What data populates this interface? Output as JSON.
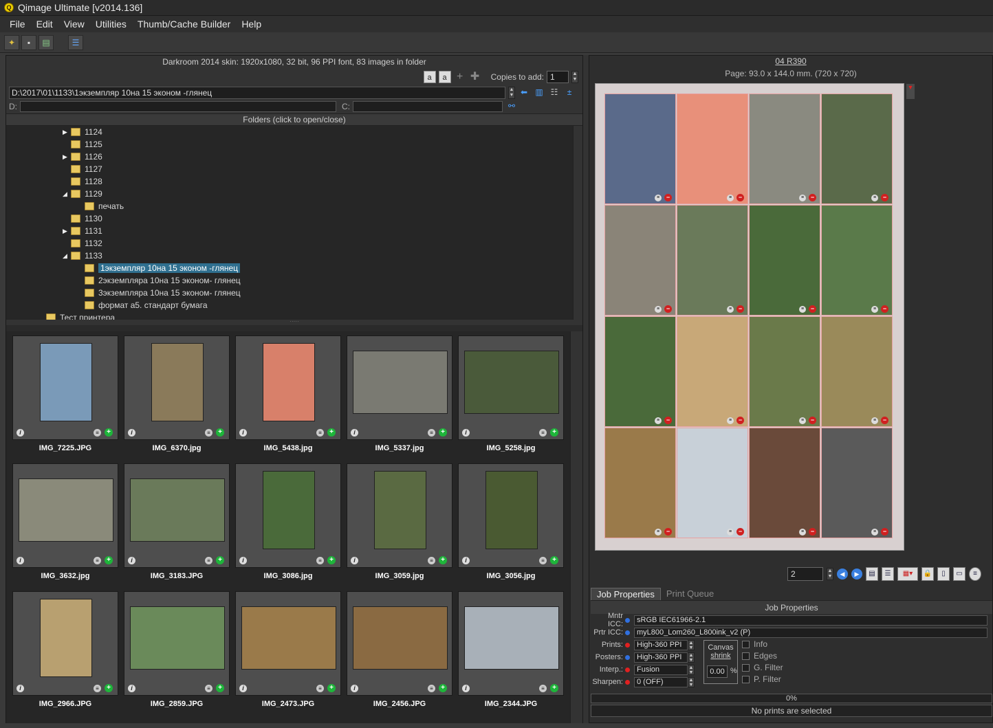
{
  "window": {
    "title": "Qimage Ultimate [v2014.136]"
  },
  "menu": [
    "File",
    "Edit",
    "View",
    "Utilities",
    "Thumb/Cache Builder",
    "Help"
  ],
  "left": {
    "skin_info": "Darkroom 2014 skin: 1920x1080, 32 bit, 96 PPI font, 83 images in folder",
    "copies_label": "Copies to add:",
    "copies_value": "1",
    "path": "D:\\2017\\01\\1133\\1экземпляр 10на 15 эконом -глянец",
    "drive_d": "D:",
    "drive_c": "C:",
    "folders_header": "Folders (click to open/close)",
    "tree": [
      {
        "label": "1124",
        "arrow": "▶"
      },
      {
        "label": "1125",
        "arrow": ""
      },
      {
        "label": "1126",
        "arrow": "▶"
      },
      {
        "label": "1127",
        "arrow": ""
      },
      {
        "label": "1128",
        "arrow": ""
      },
      {
        "label": "1129",
        "arrow": "◢"
      },
      {
        "label": "печать",
        "arrow": ""
      },
      {
        "label": "1130",
        "arrow": ""
      },
      {
        "label": "1131",
        "arrow": "▶"
      },
      {
        "label": "1132",
        "arrow": ""
      },
      {
        "label": "1133",
        "arrow": "◢"
      },
      {
        "label": "1экземпляр 10на 15 эконом -глянец",
        "arrow": ""
      },
      {
        "label": "2экземпляра  10на 15 эконом- глянец",
        "arrow": ""
      },
      {
        "label": "3экземпляра  10на 15 эконом- глянец",
        "arrow": ""
      },
      {
        "label": "формат а5. стандарт бумага",
        "arrow": ""
      },
      {
        "label": "Тест принтера",
        "arrow": ""
      }
    ],
    "thumbnails": [
      {
        "name": "IMG_7225.JPG",
        "color": "#7a9ab8"
      },
      {
        "name": "IMG_6370.jpg",
        "color": "#8a7a5a"
      },
      {
        "name": "IMG_5438.jpg",
        "color": "#d8806a"
      },
      {
        "name": "IMG_5337.jpg",
        "color": "#7a7a72"
      },
      {
        "name": "IMG_5258.jpg",
        "color": "#4a5a3a"
      },
      {
        "name": "IMG_3632.jpg",
        "color": "#8a8a7a"
      },
      {
        "name": "IMG_3183.JPG",
        "color": "#6a7a5a"
      },
      {
        "name": "IMG_3086.jpg",
        "color": "#4a6a3a"
      },
      {
        "name": "IMG_3059.jpg",
        "color": "#5a6a42"
      },
      {
        "name": "IMG_3056.jpg",
        "color": "#4a5a32"
      },
      {
        "name": "IMG_2966.JPG",
        "color": "#b8a070"
      },
      {
        "name": "IMG_2859.JPG",
        "color": "#6a8a5a"
      },
      {
        "name": "IMG_2473.JPG",
        "color": "#9a7a4a"
      },
      {
        "name": "IMG_2456.JPG",
        "color": "#8a6a42"
      },
      {
        "name": "IMG_2344.JPG",
        "color": "#a8b0b8"
      }
    ]
  },
  "right": {
    "printer_title": "04 R390",
    "page_info": "Page: 93.0 x 144.0 mm.  (720 x 720)",
    "page_number": "2",
    "page_images": [
      "#5a6a8a",
      "#e8907a",
      "#8a8a80",
      "#5a6a4a",
      "#8a8478",
      "#6a7a5a",
      "#4a6a3a",
      "#5a7a4a",
      "#4a6a3a",
      "#c8a878",
      "#6a7a4a",
      "#9a8a5a",
      "#9a7a4a",
      "#c8d0d8",
      "#6a4a3a",
      "#5a5a5a"
    ],
    "tabs": [
      "Job Properties",
      "Print Queue"
    ],
    "job_header": "Job Properties",
    "job": [
      {
        "label": "Mntr ICC:",
        "value": "sRGB IEC61966-2.1",
        "dot": "#3070e0"
      },
      {
        "label": "Prtr ICC:",
        "value": "myL800_Lom260_L800ink_v2 (P)",
        "dot": "#3070e0"
      },
      {
        "label": "Prints:",
        "value": "High-360 PPI",
        "dot": "#e02020"
      },
      {
        "label": "Posters:",
        "value": "High-360 PPI",
        "dot": "#3070e0"
      },
      {
        "label": "Interp.:",
        "value": "Fusion",
        "dot": "#e02020"
      },
      {
        "label": "Sharpen:",
        "value": "0 (OFF)",
        "dot": "#e02020"
      }
    ],
    "canvas": {
      "label": "Canvas",
      "link": "shrink",
      "value": "0.00",
      "unit": "%"
    },
    "checks": [
      "Info",
      "Edges",
      "G. Filter",
      "P. Filter"
    ],
    "progress": "0%",
    "status": "No prints are selected"
  }
}
